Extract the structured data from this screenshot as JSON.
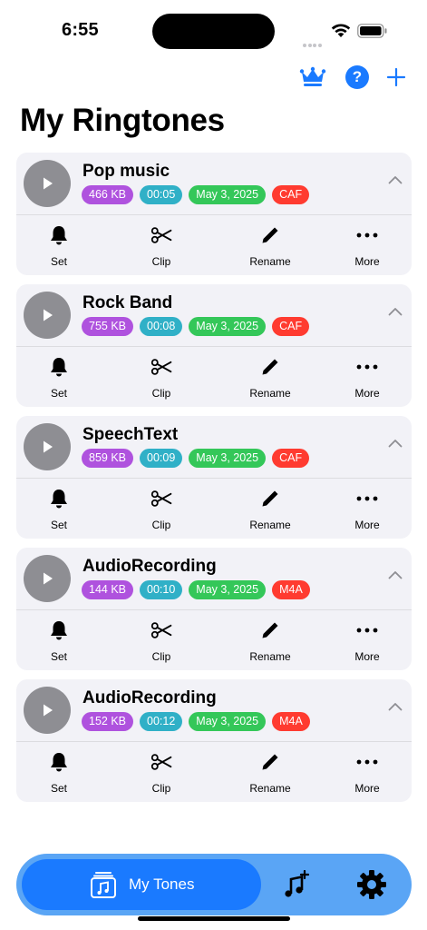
{
  "status_bar": {
    "time": "6:55"
  },
  "header": {
    "title": "My Ringtones",
    "help_label": "?"
  },
  "actions": {
    "set": "Set",
    "clip": "Clip",
    "rename": "Rename",
    "more": "More"
  },
  "ringtones": [
    {
      "name": "Pop music",
      "size": "466 KB",
      "duration": "00:05",
      "date": "May 3, 2025",
      "format": "CAF"
    },
    {
      "name": "Rock Band",
      "size": "755 KB",
      "duration": "00:08",
      "date": "May 3, 2025",
      "format": "CAF"
    },
    {
      "name": "SpeechText",
      "size": "859 KB",
      "duration": "00:09",
      "date": "May 3, 2025",
      "format": "CAF"
    },
    {
      "name": "AudioRecording",
      "size": "144 KB",
      "duration": "00:10",
      "date": "May 3, 2025",
      "format": "M4A"
    },
    {
      "name": "AudioRecording",
      "size": "152 KB",
      "duration": "00:12",
      "date": "May 3, 2025",
      "format": "M4A"
    }
  ],
  "tab_bar": {
    "my_tones": "My Tones"
  },
  "colors": {
    "accent": "#1a7aff",
    "tab_bar_bg": "#5aa5f5",
    "size_badge": "#af52de",
    "duration_badge": "#30b0c7",
    "date_badge": "#34c759",
    "format_badge": "#ff3b30",
    "card_bg": "#f2f2f7",
    "play_button": "#8e8e93"
  },
  "icons": {
    "status": [
      "signal-icon",
      "wifi-icon",
      "battery-icon"
    ],
    "header": [
      "crown-icon",
      "help-icon",
      "plus-icon"
    ],
    "card": [
      "play-icon",
      "chevron-up-icon",
      "bell-icon",
      "scissors-icon",
      "pencil-icon",
      "ellipsis-icon"
    ],
    "tab_bar": [
      "music-library-icon",
      "add-music-icon",
      "gear-icon"
    ]
  }
}
